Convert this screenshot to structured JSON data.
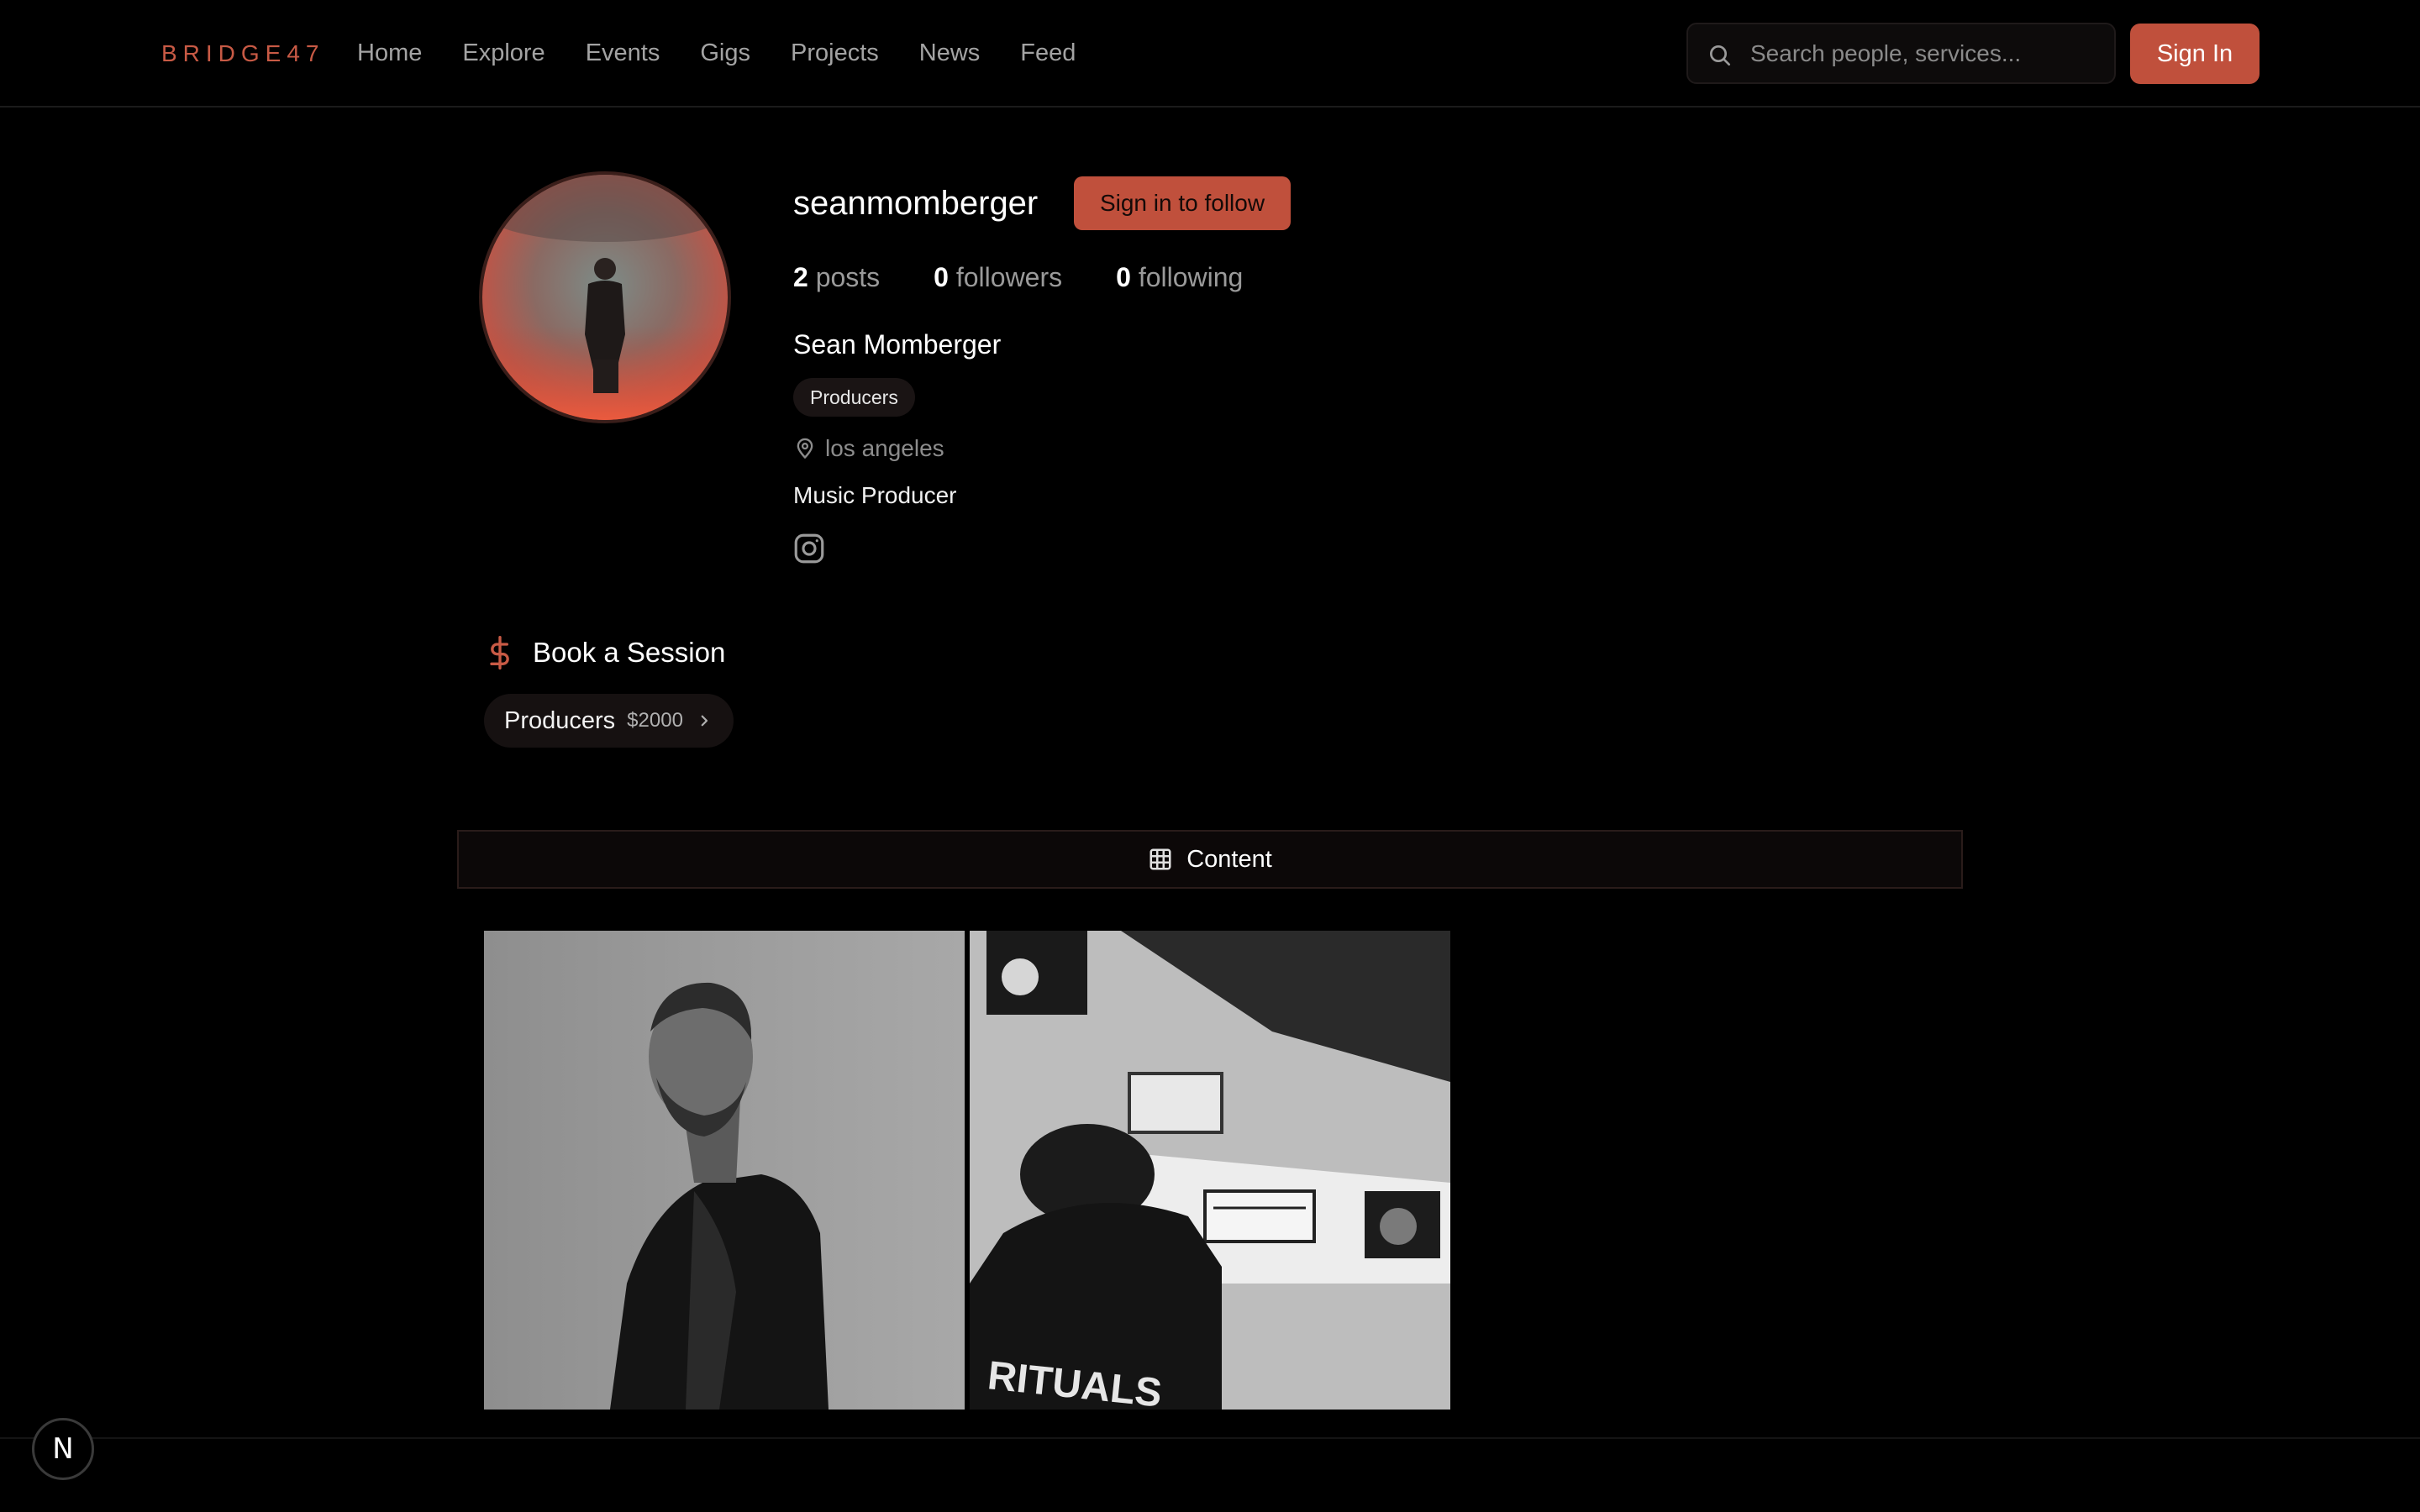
{
  "header": {
    "brand": "BRIDGE47",
    "nav": [
      "Home",
      "Explore",
      "Events",
      "Gigs",
      "Projects",
      "News",
      "Feed"
    ],
    "search_placeholder": "Search people, services...",
    "signin_label": "Sign In"
  },
  "profile": {
    "username": "seanmomberger",
    "follow_label": "Sign in to follow",
    "stats": {
      "posts": "2",
      "posts_label": "posts",
      "followers": "0",
      "followers_label": "followers",
      "following": "0",
      "following_label": "following"
    },
    "full_name": "Sean Momberger",
    "tag": "Producers",
    "location": "los angeles",
    "bio": "Music Producer",
    "social_icon": "instagram-icon"
  },
  "booking": {
    "title": "Book a Session",
    "service_name": "Producers",
    "service_price": "$2000"
  },
  "tabs": {
    "content_label": "Content"
  },
  "footer": {
    "badge": "N"
  },
  "colors": {
    "accent": "#c0503c",
    "brand": "#c85a45",
    "background": "#000000",
    "muted_text": "#9a9a9a"
  }
}
